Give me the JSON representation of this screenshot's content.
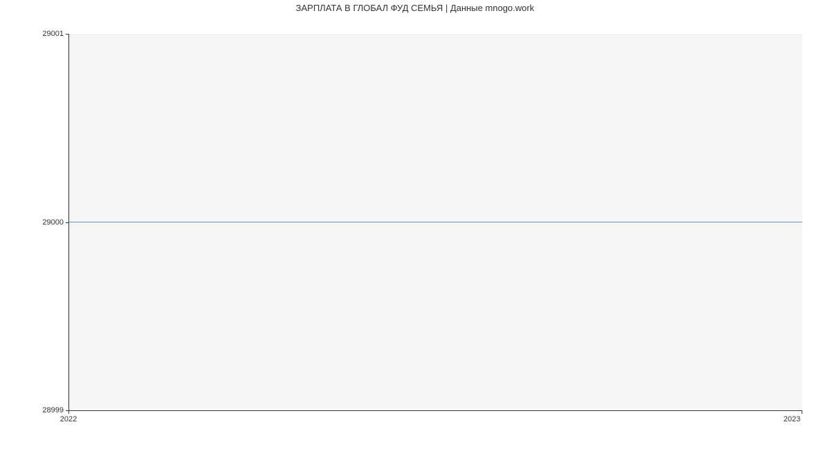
{
  "chart_data": {
    "type": "line",
    "title": "ЗАРПЛАТА В ГЛОБАЛ ФУД СЕМЬЯ | Данные mnogo.work",
    "xlabel": "",
    "ylabel": "",
    "x": [
      "2022",
      "2023"
    ],
    "values": [
      29000,
      29000
    ],
    "xlim": [
      "2022",
      "2023"
    ],
    "ylim": [
      28999,
      29001
    ],
    "y_ticks": [
      28999,
      29000,
      29001
    ],
    "x_ticks": [
      "2022",
      "2023"
    ],
    "line_color": "#6494d4"
  }
}
